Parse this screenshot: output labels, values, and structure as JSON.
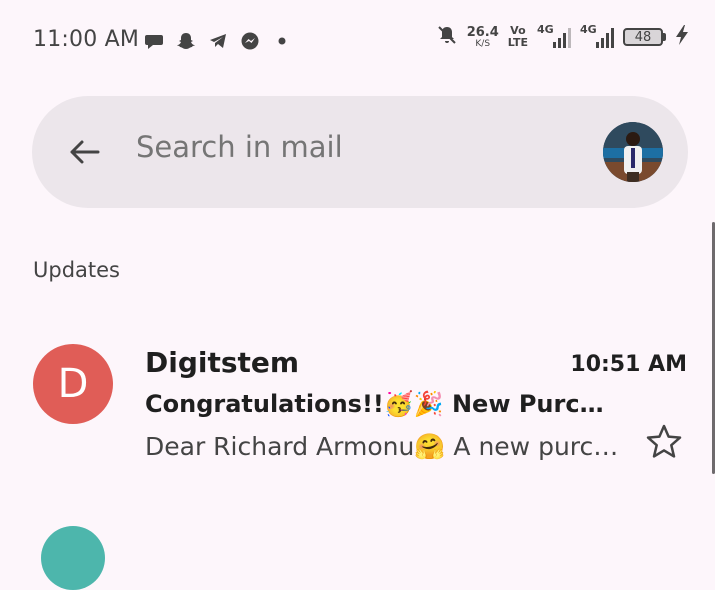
{
  "status_bar": {
    "time": "11:00 AM",
    "notification_icons": [
      "chat-bubble-icon",
      "snapchat-icon",
      "telegram-icon",
      "messenger-icon",
      "more-dot-icon"
    ],
    "net_speed_value": "26.4",
    "net_speed_unit": "K/S",
    "volte_top": "Vo",
    "volte_bottom": "LTE",
    "signal_1_label": "4G",
    "signal_2_label": "4G",
    "battery_level": "48",
    "icons": [
      "mute-bell-icon",
      "charging-bolt-icon"
    ]
  },
  "search": {
    "placeholder": "Search in mail"
  },
  "section": {
    "label": "Updates"
  },
  "mail": {
    "avatar_letter": "D",
    "avatar_color": "#e05d57",
    "sender": "Digitstem",
    "time": "10:51 AM",
    "subject": "Congratulations!!🥳🎉 New Purc…",
    "snippet": "Dear Richard Armonu🤗 A new purc…",
    "starred": false
  },
  "colors": {
    "background": "#fdf6fb",
    "search_bar": "#ece6eb"
  }
}
